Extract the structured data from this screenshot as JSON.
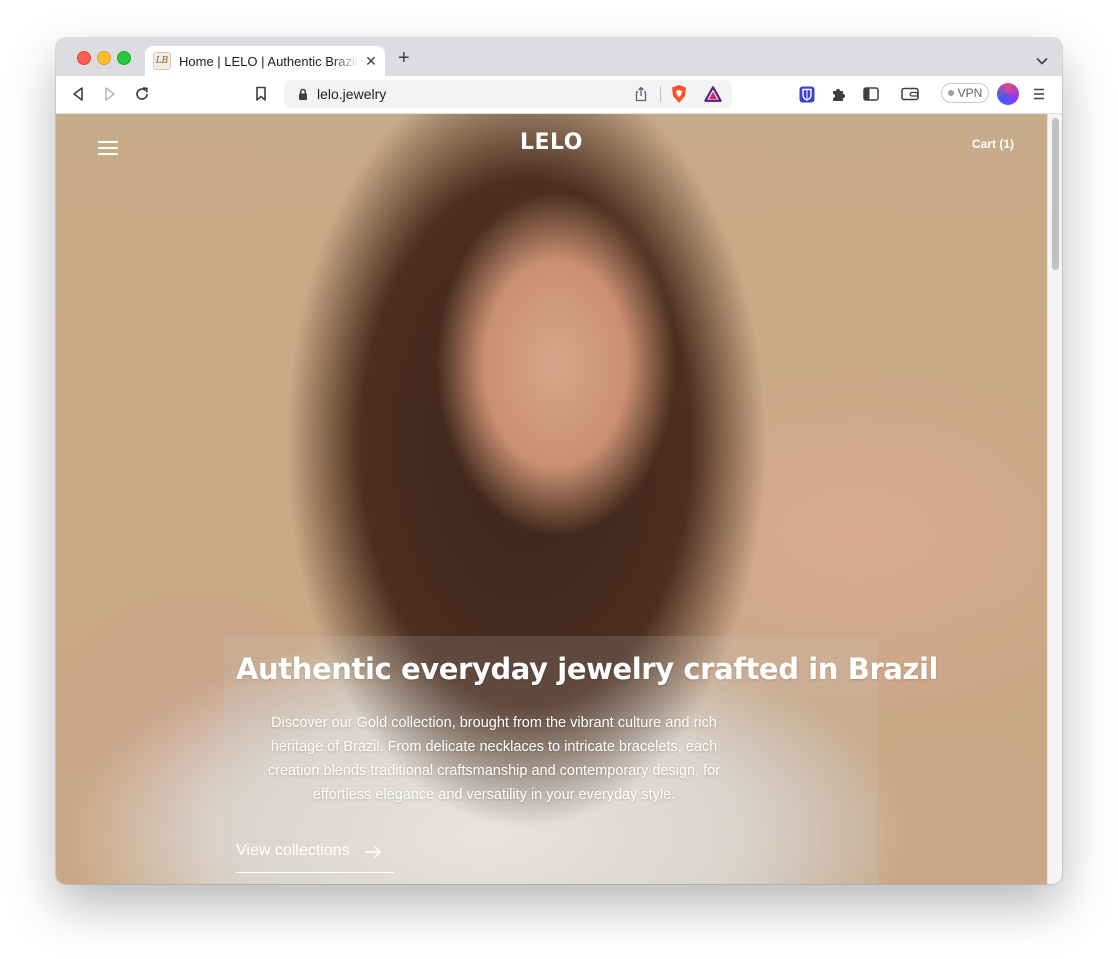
{
  "browser": {
    "tab": {
      "title": "Home | LELO | Authentic Brazilian Jewelry",
      "favicon_text": "LB"
    },
    "url": "lelo.jewelry",
    "vpn_label": "VPN"
  },
  "site": {
    "brand": "LELO",
    "cart_label": "Cart (1)",
    "hero": {
      "headline": "Authentic everyday jewelry crafted in Brazil",
      "description": "Discover our Gold collection, brought from the vibrant culture and rich heritage of Brazil. From delicate necklaces to intricate bracelets, each creation blends traditional craftsmanship and contemporary design, for effortless elegance and versatility in your everyday style.",
      "cta_label": "View collections"
    }
  },
  "icons": {
    "back": "back-arrow-icon",
    "forward": "forward-arrow-icon",
    "reload": "reload-icon",
    "bookmark": "bookmark-icon",
    "lock": "lock-icon",
    "share": "share-icon",
    "brave": "brave-shields-icon",
    "rewards": "brave-rewards-icon",
    "bitwarden": "bitwarden-icon",
    "extensions": "puzzle-icon",
    "sidebar": "sidebar-icon",
    "wallet": "wallet-icon",
    "menu": "hamburger-menu-icon"
  },
  "colors": {
    "hero_bg": "#c9a887",
    "text_on_hero": "#ffffff"
  }
}
